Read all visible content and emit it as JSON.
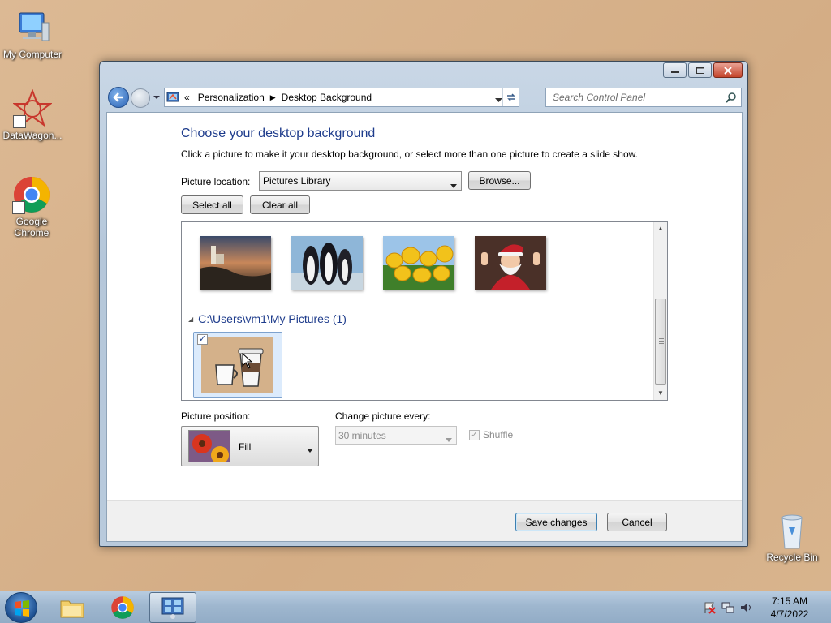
{
  "desktop": {
    "icons": [
      {
        "label": "My Computer"
      },
      {
        "label": "DataWagon..."
      },
      {
        "label": "Google Chrome"
      }
    ],
    "recycle_bin": {
      "label": "Recycle Bin"
    }
  },
  "window": {
    "address": {
      "chevrons": "«",
      "crumbs": [
        "Personalization",
        "Desktop Background"
      ]
    },
    "search": {
      "placeholder": "Search Control Panel"
    },
    "title": "Choose your desktop background",
    "subtitle": "Click a picture to make it your desktop background, or select more than one picture to create a slide show.",
    "picture_location": {
      "label": "Picture location:",
      "value": "Pictures Library"
    },
    "browse_label": "Browse...",
    "select_all_label": "Select all",
    "clear_all_label": "Clear all",
    "gallery": {
      "group_header": "C:\\Users\\vm1\\My Pictures (1)",
      "thumbnails": [
        "lighthouse",
        "penguins",
        "tulips",
        "santa"
      ],
      "selected_item_checked": "✓"
    },
    "picture_position": {
      "label": "Picture position:",
      "value": "Fill"
    },
    "change_every": {
      "label": "Change picture every:",
      "value": "30 minutes"
    },
    "shuffle": {
      "label": "Shuffle",
      "checked": true
    },
    "save_label": "Save changes",
    "cancel_label": "Cancel"
  },
  "taskbar": {
    "clock_time": "7:15 AM",
    "clock_date": "4/7/2022"
  },
  "colors": {
    "title_blue": "#1e3c8c",
    "desktop_bg": "#d9b58f",
    "taskbar": "#9fb7cf"
  }
}
